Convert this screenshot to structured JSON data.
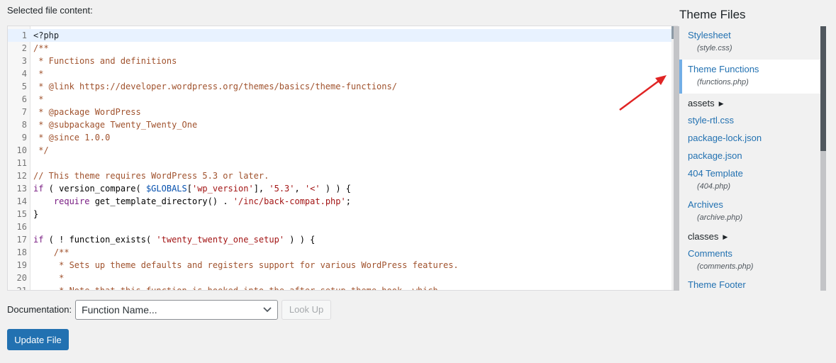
{
  "editor": {
    "label": "Selected file content:",
    "lines": [
      {
        "n": "1",
        "tokens": [
          {
            "t": "<?php",
            "c": "c-def"
          }
        ]
      },
      {
        "n": "2",
        "tokens": [
          {
            "t": "/**",
            "c": "c-cmt"
          }
        ]
      },
      {
        "n": "3",
        "tokens": [
          {
            "t": " * Functions and definitions",
            "c": "c-cmt"
          }
        ]
      },
      {
        "n": "4",
        "tokens": [
          {
            "t": " *",
            "c": "c-cmt"
          }
        ]
      },
      {
        "n": "5",
        "tokens": [
          {
            "t": " * @link https://developer.wordpress.org/themes/basics/theme-functions/",
            "c": "c-cmt"
          }
        ]
      },
      {
        "n": "6",
        "tokens": [
          {
            "t": " *",
            "c": "c-cmt"
          }
        ]
      },
      {
        "n": "7",
        "tokens": [
          {
            "t": " * @package WordPress",
            "c": "c-cmt"
          }
        ]
      },
      {
        "n": "8",
        "tokens": [
          {
            "t": " * @subpackage Twenty_Twenty_One",
            "c": "c-cmt"
          }
        ]
      },
      {
        "n": "9",
        "tokens": [
          {
            "t": " * @since 1.0.0",
            "c": "c-cmt"
          }
        ]
      },
      {
        "n": "10",
        "tokens": [
          {
            "t": " */",
            "c": "c-cmt"
          }
        ]
      },
      {
        "n": "11",
        "tokens": [
          {
            "t": "",
            "c": "c-def"
          }
        ]
      },
      {
        "n": "12",
        "tokens": [
          {
            "t": "// This theme requires WordPress 5.3 or later.",
            "c": "c-cmt"
          }
        ]
      },
      {
        "n": "13",
        "tokens": [
          {
            "t": "if",
            "c": "c-kw"
          },
          {
            "t": " ( version_compare( ",
            "c": "c-fn"
          },
          {
            "t": "$GLOBALS",
            "c": "c-var"
          },
          {
            "t": "[",
            "c": "c-fn"
          },
          {
            "t": "'wp_version'",
            "c": "c-str"
          },
          {
            "t": "], ",
            "c": "c-fn"
          },
          {
            "t": "'5.3'",
            "c": "c-str"
          },
          {
            "t": ", ",
            "c": "c-fn"
          },
          {
            "t": "'<'",
            "c": "c-str"
          },
          {
            "t": " ) ) {",
            "c": "c-fn"
          }
        ]
      },
      {
        "n": "14",
        "tokens": [
          {
            "t": "    require",
            "c": "c-kw"
          },
          {
            "t": " get_template_directory() . ",
            "c": "c-fn"
          },
          {
            "t": "'/inc/back-compat.php'",
            "c": "c-str"
          },
          {
            "t": ";",
            "c": "c-fn"
          }
        ]
      },
      {
        "n": "15",
        "tokens": [
          {
            "t": "}",
            "c": "c-fn"
          }
        ]
      },
      {
        "n": "16",
        "tokens": [
          {
            "t": "",
            "c": "c-def"
          }
        ]
      },
      {
        "n": "17",
        "tokens": [
          {
            "t": "if",
            "c": "c-kw"
          },
          {
            "t": " ( ! function_exists( ",
            "c": "c-fn"
          },
          {
            "t": "'twenty_twenty_one_setup'",
            "c": "c-str"
          },
          {
            "t": " ) ) {",
            "c": "c-fn"
          }
        ]
      },
      {
        "n": "18",
        "tokens": [
          {
            "t": "    /**",
            "c": "c-cmt"
          }
        ]
      },
      {
        "n": "19",
        "tokens": [
          {
            "t": "     * Sets up theme defaults and registers support for various WordPress features.",
            "c": "c-cmt"
          }
        ]
      },
      {
        "n": "20",
        "tokens": [
          {
            "t": "     *",
            "c": "c-cmt"
          }
        ]
      },
      {
        "n": "21",
        "tokens": [
          {
            "t": "     * Note that this function is hooked into the after_setup_theme hook, which",
            "c": "c-cmt"
          }
        ]
      }
    ]
  },
  "documentation": {
    "label": "Documentation:",
    "select_value": "Function Name...",
    "lookup_label": "Look Up"
  },
  "update_button": "Update File",
  "theme_files": {
    "title": "Theme Files",
    "items": [
      {
        "type": "file",
        "label": "Stylesheet",
        "sub": "(style.css)",
        "current": false,
        "icon": ""
      },
      {
        "type": "file",
        "label": "Theme Functions",
        "sub": "(functions.php)",
        "current": true,
        "icon": ""
      },
      {
        "type": "folder",
        "label": "assets",
        "sub": "",
        "current": false,
        "icon": "triangle-right-icon"
      },
      {
        "type": "file",
        "label": "style-rtl.css",
        "sub": "",
        "current": false,
        "icon": ""
      },
      {
        "type": "file",
        "label": "package-lock.json",
        "sub": "",
        "current": false,
        "icon": ""
      },
      {
        "type": "file",
        "label": "package.json",
        "sub": "",
        "current": false,
        "icon": ""
      },
      {
        "type": "file",
        "label": "404 Template",
        "sub": "(404.php)",
        "current": false,
        "icon": ""
      },
      {
        "type": "file",
        "label": "Archives",
        "sub": "(archive.php)",
        "current": false,
        "icon": ""
      },
      {
        "type": "folder",
        "label": "classes",
        "sub": "",
        "current": false,
        "icon": "triangle-right-icon"
      },
      {
        "type": "file",
        "label": "Comments",
        "sub": "(comments.php)",
        "current": false,
        "icon": ""
      },
      {
        "type": "file",
        "label": "Theme Footer",
        "sub": "",
        "current": false,
        "icon": ""
      }
    ]
  },
  "colors": {
    "accent": "#2271b1",
    "arrow": "#e02424",
    "current_border": "#72aee6"
  }
}
